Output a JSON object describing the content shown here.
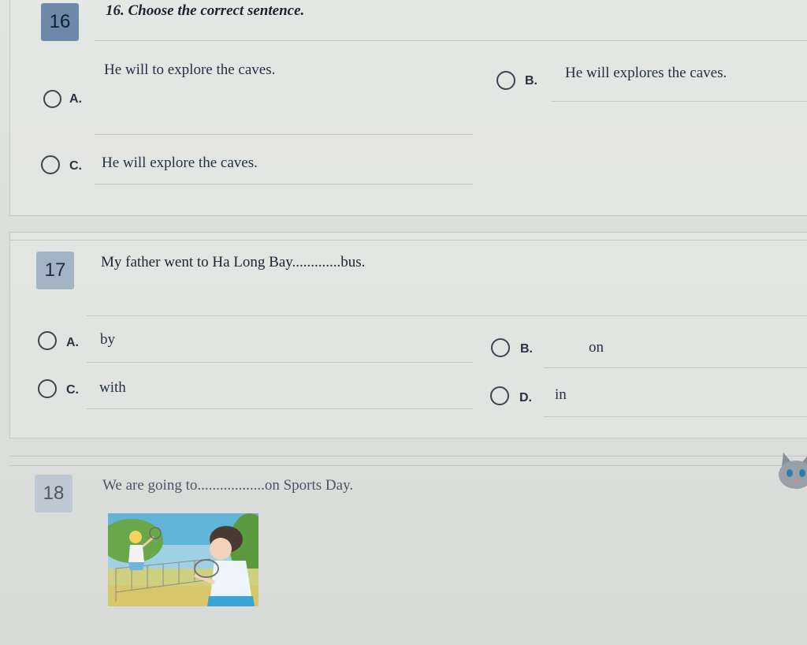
{
  "q16": {
    "number": "16",
    "prompt": "16. Choose the correct sentence.",
    "options": [
      {
        "letter": "A.",
        "text": "He will to explore the caves."
      },
      {
        "letter": "B.",
        "text": "He will explores the caves."
      },
      {
        "letter": "C.",
        "text": "He will explore the caves."
      }
    ]
  },
  "q17": {
    "number": "17",
    "prompt": "My father went to Ha Long Bay.............bus.",
    "options": [
      {
        "letter": "A.",
        "text": "by"
      },
      {
        "letter": "B.",
        "text": "on"
      },
      {
        "letter": "C.",
        "text": "with"
      },
      {
        "letter": "D.",
        "text": "in"
      }
    ]
  },
  "q18": {
    "number": "18",
    "prompt": "We are going to..................on Sports Day.",
    "image": "badminton-illustration"
  },
  "colors": {
    "number_badge": "#6f87a9",
    "radio_border": "#3d4450",
    "background": "#dcdfdc"
  }
}
